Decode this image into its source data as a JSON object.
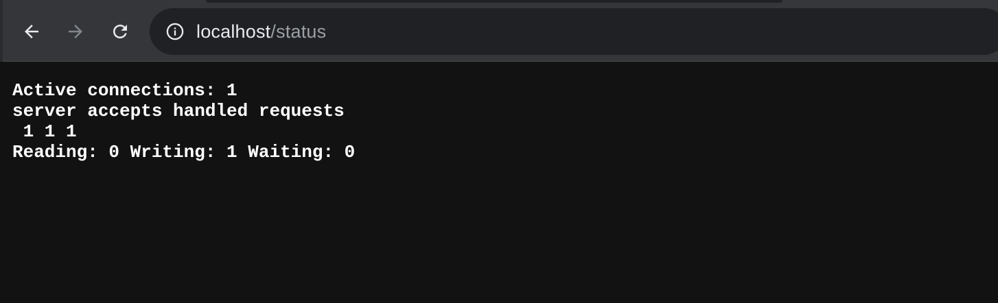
{
  "browser": {
    "address_bar": {
      "host": "localhost",
      "path": "/status"
    },
    "icons": {
      "back": "arrow-left-icon",
      "forward": "arrow-right-icon",
      "reload": "reload-icon",
      "site_info": "info-icon"
    },
    "colors": {
      "toolbar": "#35363a",
      "omnibox": "#202124",
      "page_background": "#121212",
      "text": "#ffffff"
    }
  },
  "page": {
    "lines": [
      "Active connections: 1",
      "server accepts handled requests",
      " 1 1 1",
      "Reading: 0 Writing: 1 Waiting: 0"
    ]
  }
}
